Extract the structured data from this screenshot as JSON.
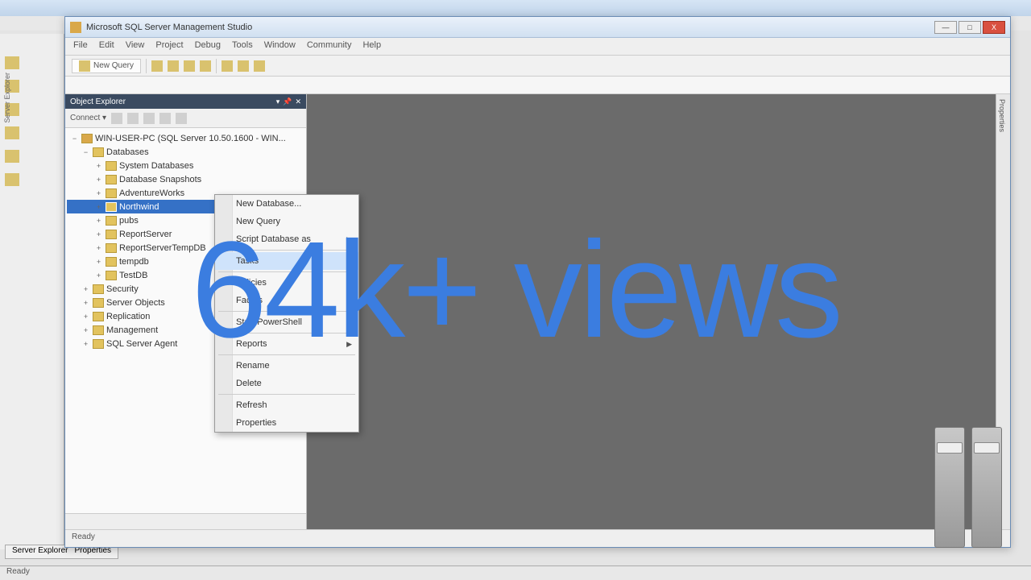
{
  "overlay_text": "64k+ views",
  "vs": {
    "title": "",
    "bottom_tabs": [
      "Server Explorer",
      "Properties"
    ],
    "status": "Ready",
    "left_label": "Server Explorer"
  },
  "ssms": {
    "title": "Microsoft SQL Server Management Studio",
    "window_buttons": {
      "min": "—",
      "max": "□",
      "close": "X"
    },
    "menu": [
      "File",
      "Edit",
      "View",
      "Project",
      "Debug",
      "Tools",
      "Window",
      "Community",
      "Help"
    ],
    "toolbar": {
      "new_query": "New Query"
    },
    "toolbar2": "",
    "status": "Ready",
    "properties_strip": "Properties"
  },
  "object_explorer": {
    "title": "Object Explorer",
    "connect_label": "Connect ▾",
    "root": "WIN-USER-PC (SQL Server 10.50.1600 - WIN...",
    "databases_label": "Databases",
    "sysdb_label": "System Databases",
    "snapshots_label": "Database Snapshots",
    "db_items": [
      "AdventureWorks",
      "Northwind",
      "pubs",
      "ReportServer",
      "ReportServerTempDB",
      "tempdb",
      "TestDB"
    ],
    "selected_db_index": 1,
    "folders": [
      "Security",
      "Server Objects",
      "Replication",
      "Management",
      "SQL Server Agent"
    ]
  },
  "context_menu": {
    "items": [
      {
        "label": "New Database...",
        "sep": false,
        "arrow": false
      },
      {
        "label": "New Query",
        "sep": false,
        "arrow": false
      },
      {
        "label": "Script Database as",
        "sep": false,
        "arrow": true
      },
      {
        "sep": true
      },
      {
        "label": "Tasks",
        "sep": false,
        "arrow": true,
        "hov": true
      },
      {
        "sep": true
      },
      {
        "label": "Policies",
        "sep": false,
        "arrow": true
      },
      {
        "label": "Facets",
        "sep": false,
        "arrow": false
      },
      {
        "sep": true
      },
      {
        "label": "Start PowerShell",
        "sep": false,
        "arrow": false
      },
      {
        "sep": true
      },
      {
        "label": "Reports",
        "sep": false,
        "arrow": true
      },
      {
        "sep": true
      },
      {
        "label": "Rename",
        "sep": false,
        "arrow": false
      },
      {
        "label": "Delete",
        "sep": false,
        "arrow": false
      },
      {
        "sep": true
      },
      {
        "label": "Refresh",
        "sep": false,
        "arrow": false
      },
      {
        "label": "Properties",
        "sep": false,
        "arrow": false
      }
    ]
  }
}
